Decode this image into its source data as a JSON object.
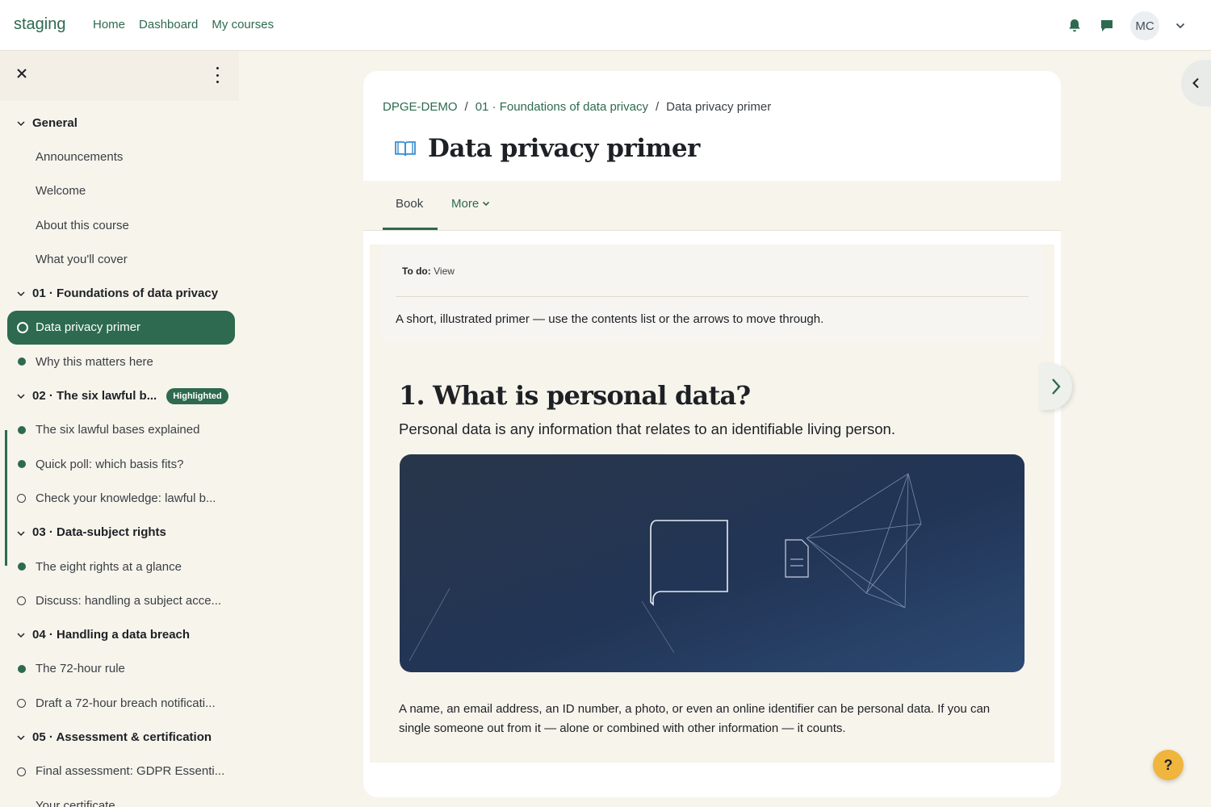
{
  "topnav": {
    "brand": "staging",
    "links": [
      "Home",
      "Dashboard",
      "My courses"
    ],
    "avatar_initials": "MC"
  },
  "sidebar": {
    "rows": [
      {
        "type": "section",
        "label": "General"
      },
      {
        "type": "item",
        "label": "Announcements",
        "status": "none"
      },
      {
        "type": "item",
        "label": "Welcome",
        "status": "none"
      },
      {
        "type": "item",
        "label": "About this course",
        "status": "none"
      },
      {
        "type": "item",
        "label": "What you'll cover",
        "status": "none"
      },
      {
        "type": "section",
        "label": "01 · Foundations of data privacy"
      },
      {
        "type": "item",
        "label": "Data privacy primer",
        "status": "todo",
        "active": true
      },
      {
        "type": "item",
        "label": "Why this matters here",
        "status": "done"
      },
      {
        "type": "section",
        "label": "02 · The six lawful b...",
        "badge": "Highlighted"
      },
      {
        "type": "item",
        "label": "The six lawful bases explained",
        "status": "done"
      },
      {
        "type": "item",
        "label": "Quick poll: which basis fits?",
        "status": "done"
      },
      {
        "type": "item",
        "label": "Check your knowledge: lawful b...",
        "status": "todo"
      },
      {
        "type": "section",
        "label": "03 · Data-subject rights"
      },
      {
        "type": "item",
        "label": "The eight rights at a glance",
        "status": "done"
      },
      {
        "type": "item",
        "label": "Discuss: handling a subject acce...",
        "status": "todo"
      },
      {
        "type": "section",
        "label": "04 · Handling a data breach"
      },
      {
        "type": "item",
        "label": "The 72-hour rule",
        "status": "done"
      },
      {
        "type": "item",
        "label": "Draft a 72-hour breach notificati...",
        "status": "todo"
      },
      {
        "type": "section",
        "label": "05 · Assessment & certification"
      },
      {
        "type": "item",
        "label": "Final assessment: GDPR Essenti...",
        "status": "todo"
      },
      {
        "type": "item",
        "label": "Your certificate",
        "status": "none"
      }
    ]
  },
  "breadcrumb": {
    "course": "DPGE-DEMO",
    "section": "01 · Foundations of data privacy",
    "current": "Data privacy primer",
    "separator": "/"
  },
  "page": {
    "title": "Data privacy primer"
  },
  "tabs": {
    "book": "Book",
    "more": "More"
  },
  "todo": {
    "label": "To do:",
    "value": "View",
    "description": "A short, illustrated primer — use the contents list or the arrows to move through."
  },
  "chapter": {
    "heading": "1. What is personal data?",
    "subheading": "Personal data is any information that relates to an identifiable living person.",
    "body": "A name, an email address, an ID number, a photo, or even an online identifier can be personal data. If you can single someone out from it — alone or combined with other information — it counts."
  },
  "help": {
    "label": "?"
  },
  "colors": {
    "primary": "#2d6a4f",
    "background": "#f7f4ec",
    "help": "#f0b53d",
    "illustration_dark": "#1f2d45"
  }
}
